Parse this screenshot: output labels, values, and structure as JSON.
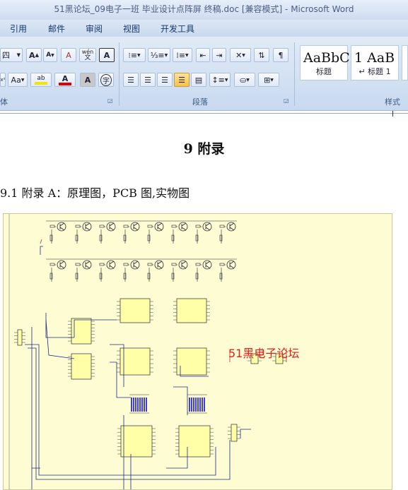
{
  "window": {
    "title": "51黑论坛_09电子一班 毕业设计点阵屏 终稿.doc [兼容模式] - Microsoft Word"
  },
  "menu": [
    "引用",
    "邮件",
    "审阅",
    "视图",
    "开发工具"
  ],
  "ribbon": {
    "font": {
      "size_value": "四",
      "grow_label": "A",
      "shrink_label": "A",
      "clear_format_label": "A",
      "phonetic_label": "wén",
      "border_char_label": "A",
      "superscript_label": "x²",
      "case_label": "Aa",
      "highlight_label": "ab",
      "font_color_label": "A",
      "char_shading_label": "A",
      "enclose_label": "字",
      "group_label": "体"
    },
    "paragraph": {
      "group_label": "段落"
    },
    "styles": {
      "items": [
        {
          "sample": "AaBbC",
          "name": "标题"
        },
        {
          "sample": "1 AaB",
          "name": "↵ 标题 1"
        }
      ],
      "group_label": "样式"
    },
    "colors": {
      "highlight": "#f5e400",
      "font_color": "#e00000"
    }
  },
  "document": {
    "heading": "9   附录",
    "subheading": "9.1  附录 A：原理图，PCB 图,实物图",
    "watermark": "51黑电子论坛"
  }
}
